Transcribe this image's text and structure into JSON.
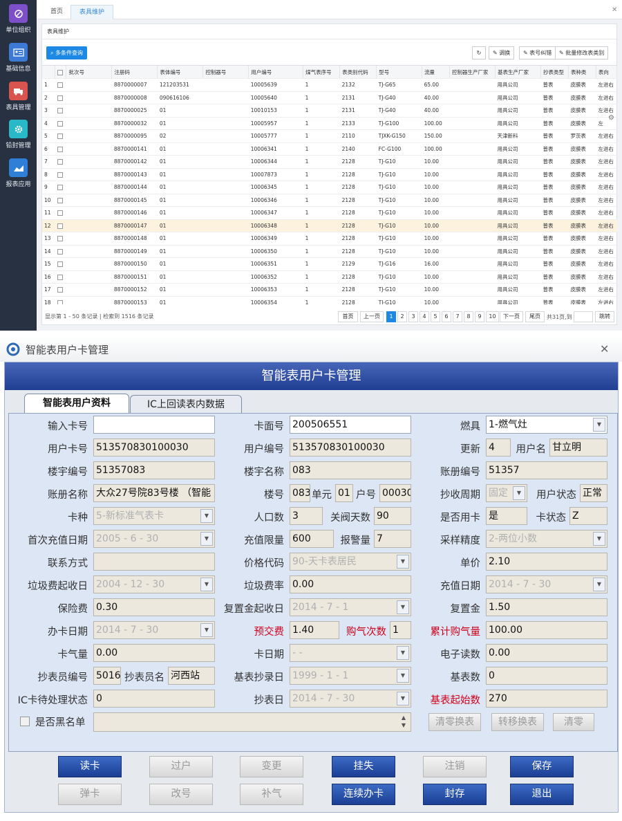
{
  "app": {
    "sidebar": [
      {
        "label": "单位组织",
        "icon": "org-icon",
        "color": "#7d4fc9"
      },
      {
        "label": "基础信息",
        "icon": "id-card-icon",
        "color": "#3d7ad6"
      },
      {
        "label": "表具管理",
        "icon": "truck-icon",
        "color": "#d9534f"
      },
      {
        "label": "铅封管理",
        "icon": "gear-icon",
        "color": "#28b8c8"
      },
      {
        "label": "报表应用",
        "icon": "chart-icon",
        "color": "#2f7fd6"
      }
    ],
    "tabs": [
      "首页",
      "表具维护"
    ],
    "panel_title": "表具维护",
    "query_label": "多条件查询",
    "toolbar": [
      "调换",
      "表号纠错",
      "批量修改表类别"
    ],
    "columns": [
      "",
      "",
      "批次号",
      "注册码",
      "表体编号",
      "控制器号",
      "用户编号",
      "煤气表序号",
      "表类别代码",
      "型号",
      "流量",
      "控制器生产厂家",
      "基表生产厂家",
      "抄表类型",
      "表种类",
      "表向"
    ],
    "rows": [
      [
        "1",
        "",
        "8870000007",
        "121203531",
        "",
        "10005639",
        "1",
        "2132",
        "TJ-G65",
        "65.00",
        "",
        "用具公司",
        "普表",
        "皮膜表",
        "左进右"
      ],
      [
        "2",
        "",
        "8870000008",
        "090616106",
        "",
        "10005640",
        "1",
        "2131",
        "TJ-G40",
        "40.00",
        "",
        "用具公司",
        "普表",
        "皮膜表",
        "左进右"
      ],
      [
        "3",
        "",
        "8870000025",
        "01",
        "",
        "10010153",
        "1",
        "2131",
        "TJ-G40",
        "40.00",
        "",
        "用具公司",
        "普表",
        "皮膜表",
        "左进右"
      ],
      [
        "4",
        "",
        "8870000032",
        "01",
        "",
        "10005957",
        "1",
        "2133",
        "TJ-G100",
        "100.00",
        "",
        "用具公司",
        "普表",
        "皮膜表",
        "左"
      ],
      [
        "5",
        "",
        "8870000095",
        "02",
        "",
        "10005777",
        "1",
        "2110",
        "TJXK-G150",
        "150.00",
        "",
        "天津新科",
        "普表",
        "罗茨表",
        "左进右"
      ],
      [
        "6",
        "",
        "8870000141",
        "01",
        "",
        "10006341",
        "1",
        "2140",
        "FC-G100",
        "100.00",
        "",
        "用具公司",
        "普表",
        "皮膜表",
        "左进右"
      ],
      [
        "7",
        "",
        "8870000142",
        "01",
        "",
        "10006344",
        "1",
        "2128",
        "TJ-G10",
        "10.00",
        "",
        "用具公司",
        "普表",
        "皮膜表",
        "左进右"
      ],
      [
        "8",
        "",
        "8870000143",
        "01",
        "",
        "10007873",
        "1",
        "2128",
        "TJ-G10",
        "10.00",
        "",
        "用具公司",
        "普表",
        "皮膜表",
        "左进右"
      ],
      [
        "9",
        "",
        "8870000144",
        "01",
        "",
        "10006345",
        "1",
        "2128",
        "TJ-G10",
        "10.00",
        "",
        "用具公司",
        "普表",
        "皮膜表",
        "左进右"
      ],
      [
        "10",
        "",
        "8870000145",
        "01",
        "",
        "10006346",
        "1",
        "2128",
        "TJ-G10",
        "10.00",
        "",
        "用具公司",
        "普表",
        "皮膜表",
        "左进右"
      ],
      [
        "11",
        "",
        "8870000146",
        "01",
        "",
        "10006347",
        "1",
        "2128",
        "TJ-G10",
        "10.00",
        "",
        "用具公司",
        "普表",
        "皮膜表",
        "左进右"
      ],
      [
        "12",
        "",
        "8870000147",
        "01",
        "",
        "10006348",
        "1",
        "2128",
        "TJ-G10",
        "10.00",
        "",
        "用具公司",
        "普表",
        "皮膜表",
        "左进右"
      ],
      [
        "13",
        "",
        "8870000148",
        "01",
        "",
        "10006349",
        "1",
        "2128",
        "TJ-G10",
        "10.00",
        "",
        "用具公司",
        "普表",
        "皮膜表",
        "左进右"
      ],
      [
        "14",
        "",
        "8870000149",
        "01",
        "",
        "10006350",
        "1",
        "2128",
        "TJ-G10",
        "10.00",
        "",
        "用具公司",
        "普表",
        "皮膜表",
        "左进右"
      ],
      [
        "15",
        "",
        "8870000150",
        "01",
        "",
        "10006351",
        "1",
        "2129",
        "TJ-G16",
        "16.00",
        "",
        "用具公司",
        "普表",
        "皮膜表",
        "左进右"
      ],
      [
        "16",
        "",
        "8870000151",
        "01",
        "",
        "10006352",
        "1",
        "2128",
        "TJ-G10",
        "10.00",
        "",
        "用具公司",
        "普表",
        "皮膜表",
        "左进右"
      ],
      [
        "17",
        "",
        "8870000152",
        "01",
        "",
        "10006353",
        "1",
        "2128",
        "TJ-G10",
        "10.00",
        "",
        "用具公司",
        "普表",
        "皮膜表",
        "左进右"
      ],
      [
        "18",
        "",
        "8870000153",
        "01",
        "",
        "10006354",
        "1",
        "2128",
        "TJ-G10",
        "10.00",
        "",
        "用具公司",
        "普表",
        "皮膜表",
        "左进右"
      ]
    ],
    "pager": {
      "info": "显示第 1 - 50 条记录 | 检索到 1516 条记录",
      "first": "首页",
      "prev": "上一页",
      "pages": [
        "1",
        "2",
        "3",
        "4",
        "5",
        "6",
        "7",
        "8",
        "9",
        "10"
      ],
      "next": "下一页",
      "last": "尾页",
      "total": "共31页,到",
      "go": "跳转"
    }
  },
  "dialog": {
    "title": "智能表用户卡管理",
    "banner": "智能表用户卡管理",
    "tabs": [
      "智能表用户资料",
      "IC上回读表内数据"
    ],
    "fields": {
      "input_card": "",
      "card_face": "200506551",
      "fuel": "1-燃气灶",
      "user_card": "513570830100030",
      "user_no": "513570830100030",
      "update": "4",
      "user_name": "甘立明",
      "building_no": "51357083",
      "building_name": "083",
      "book_no": "51357",
      "book_name": "大众27号院83号楼 （智能",
      "lou": "083",
      "unit": "01",
      "hu": "00030",
      "cycle": "固定",
      "user_status": "正常",
      "card_type": "5-新标准气表卡",
      "people": "3",
      "close_days": "90",
      "is_use": "是",
      "card_status": "Z",
      "first_charge_date": "2005 - 6 - 30",
      "charge_limit": "600",
      "alarm": "7",
      "precision": "2-两位小数",
      "contact": "",
      "price_code": "90-天卡表居民",
      "unit_price": "2.10",
      "garbage_start": "2004 - 12 - 30",
      "garbage_rate": "0.00",
      "charge_date": "2014 - 7 - 30",
      "insurance": "0.30",
      "reset_date": "2014 - 7 - 1",
      "reset_fee": "1.50",
      "card_date": "2014 - 7 - 30",
      "prepay": "1.40",
      "buy_times": "1",
      "total_buy": "100.00",
      "card_gas": "0.00",
      "card_day": "-   -",
      "e_reading": "0.00",
      "reader_no": "5016",
      "reader_name": "河西站",
      "base_read_date": "1999 - 1 - 1",
      "base_reading": "0",
      "ic_pending": "0",
      "read_date": "2014 - 7 - 30",
      "base_start": "270"
    },
    "labels": {
      "input_card": "输入卡号",
      "card_face": "卡面号",
      "fuel": "燃具",
      "user_card": "用户卡号",
      "user_no": "用户编号",
      "update": "更新",
      "user_name": "用户名",
      "building_no": "楼宇编号",
      "building_name": "楼宇名称",
      "book_no": "账册编号",
      "book_name": "账册名称",
      "lou": "楼号",
      "unit": "单元",
      "hu": "户号",
      "cycle": "抄收周期",
      "user_status": "用户状态",
      "card_type": "卡种",
      "people": "人口数",
      "close_days": "关阀天数",
      "is_use": "是否用卡",
      "card_status": "卡状态",
      "first_charge_date": "首次充值日期",
      "charge_limit": "充值限量",
      "alarm": "报警量",
      "precision": "采样精度",
      "contact": "联系方式",
      "price_code": "价格代码",
      "unit_price": "单价",
      "garbage_start": "垃圾费起收日",
      "garbage_rate": "垃圾费率",
      "charge_date": "充值日期",
      "insurance": "保险费",
      "reset_date": "复置金起收日",
      "reset_fee": "复置金",
      "card_date": "办卡日期",
      "prepay": "预交费",
      "buy_times": "购气次数",
      "total_buy": "累计购气量",
      "card_gas": "卡气量",
      "card_day": "卡日期",
      "e_reading": "电子读数",
      "reader_no": "抄表员编号",
      "reader_name": "抄表员名",
      "base_read_date": "基表抄录日",
      "base_reading": "基表数",
      "ic_pending": "IC卡待处理状态",
      "read_date": "抄表日",
      "base_start": "基表起始数",
      "blacklist": "是否黑名单"
    },
    "side_buttons": [
      "清零换表",
      "转移换表",
      "清零"
    ],
    "buttons_row1": [
      "读卡",
      "过户",
      "变更",
      "挂失",
      "注销",
      "保存"
    ],
    "buttons_row2": [
      "弹卡",
      "改号",
      "补气",
      "连续办卡",
      "封存",
      "退出"
    ]
  }
}
